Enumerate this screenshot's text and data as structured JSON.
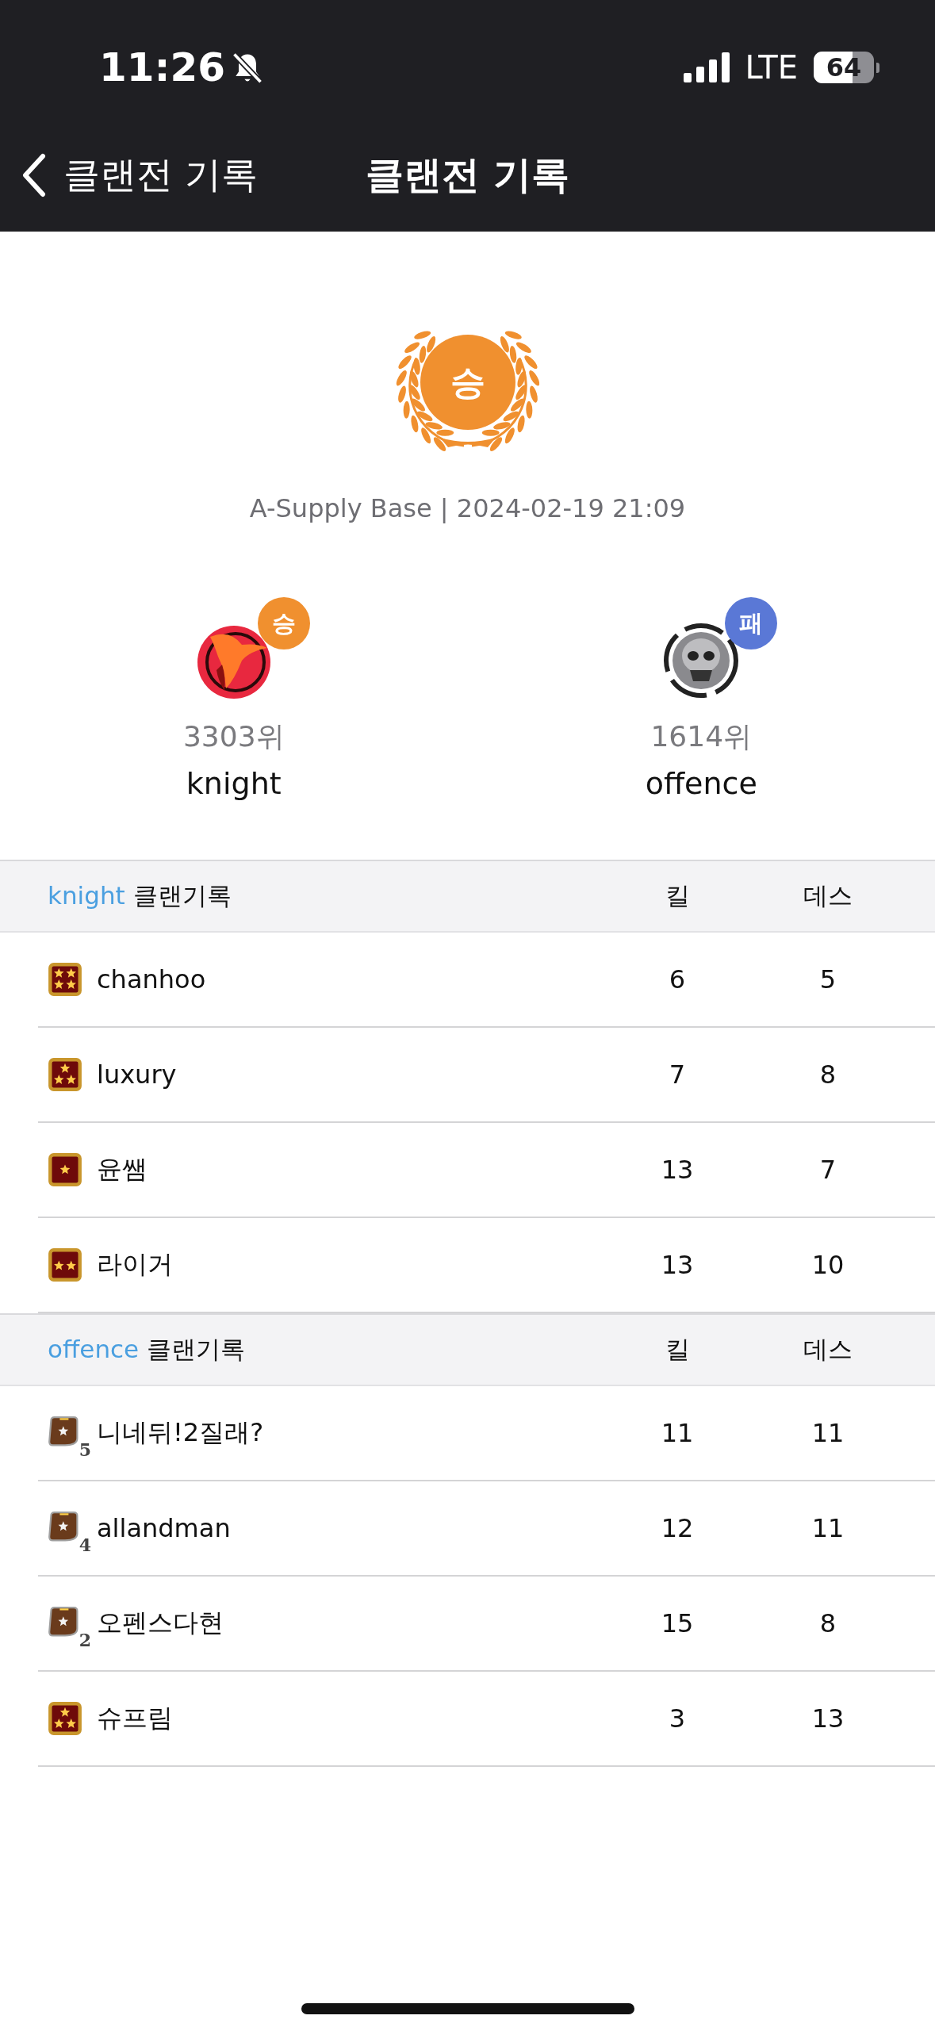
{
  "status_bar": {
    "time": "11:26",
    "network": "LTE",
    "battery": "64"
  },
  "nav": {
    "back_label": "클랜전 기록",
    "title": "클랜전 기록"
  },
  "result": {
    "label": "승",
    "kind": "win"
  },
  "match_info": "A-Supply Base | 2024-02-19 21:09",
  "teams": [
    {
      "kind": "phoenix",
      "result": {
        "label": "승",
        "kind": "win"
      },
      "rank": "3303위",
      "name": "knight"
    },
    {
      "kind": "skull",
      "result": {
        "label": "패",
        "kind": "loss"
      },
      "rank": "1614위",
      "name": "offence"
    }
  ],
  "records": [
    {
      "clan": "knight",
      "title": "클랜기록",
      "columns": [
        "킬",
        "데스"
      ],
      "rows": [
        {
          "badge": {
            "kind": "four-star"
          },
          "player": "chanhoo",
          "kills": "6",
          "deaths": "5"
        },
        {
          "badge": {
            "kind": "three-star"
          },
          "player": "luxury",
          "kills": "7",
          "deaths": "8"
        },
        {
          "badge": {
            "kind": "one-star"
          },
          "player": "윤쌤",
          "kills": "13",
          "deaths": "7"
        },
        {
          "badge": {
            "kind": "two-star"
          },
          "player": "라이거",
          "kills": "13",
          "deaths": "10"
        }
      ]
    },
    {
      "clan": "offence",
      "title": "클랜기록",
      "columns": [
        "킬",
        "데스"
      ],
      "rows": [
        {
          "badge": {
            "kind": "shield",
            "number": "5"
          },
          "player": "니네뒤!2질래?",
          "kills": "11",
          "deaths": "11"
        },
        {
          "badge": {
            "kind": "shield",
            "number": "4"
          },
          "player": "allandman",
          "kills": "12",
          "deaths": "11"
        },
        {
          "badge": {
            "kind": "shield",
            "number": "2"
          },
          "player": "오펜스다현",
          "kills": "15",
          "deaths": "8"
        },
        {
          "badge": {
            "kind": "three-star"
          },
          "player": "슈프림",
          "kills": "3",
          "deaths": "13"
        }
      ]
    }
  ]
}
